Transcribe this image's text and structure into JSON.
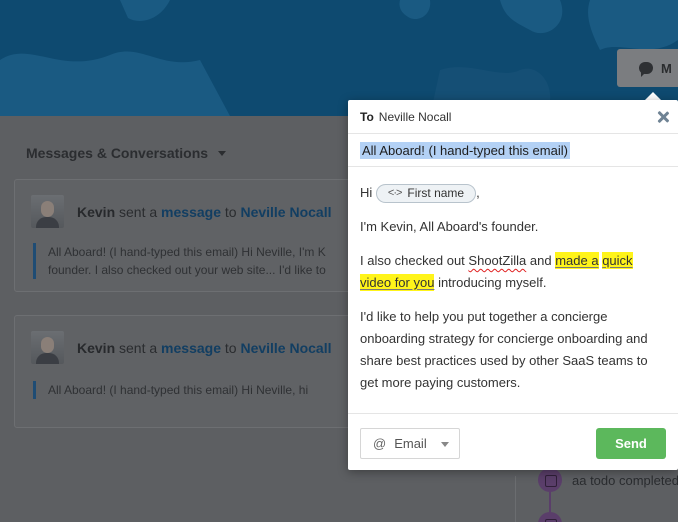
{
  "hero": {
    "button_label": "M"
  },
  "messages": {
    "section_title": "Messages & Conversations",
    "cards": [
      {
        "sender": "Kevin",
        "verb": "sent a",
        "object": "message",
        "to_word": "to",
        "recipient": "Neville Nocall",
        "preview_line1": "All Aboard! (I hand-typed this email) Hi Neville, I'm K",
        "preview_line2": "founder. I also checked out your web site... I'd like to"
      },
      {
        "sender": "Kevin",
        "verb": "sent a",
        "object": "message",
        "to_word": "to",
        "recipient": "Neville Nocall",
        "preview_line1": "All Aboard! (I hand-typed this email) Hi Neville, hi"
      }
    ]
  },
  "timeline": {
    "item_text": "aa todo completed"
  },
  "compose": {
    "to_label": "To",
    "to_name": "Neville Nocall",
    "subject": "All Aboard! (I hand-typed this email)",
    "greeting": "Hi",
    "token_label": "First name",
    "greeting_end": ",",
    "p1": "I'm Kevin, All Aboard's founder.",
    "p2_a": "I also checked out",
    "p2_brand": "ShootZilla",
    "p2_and": "and",
    "p2_hl1": "made a",
    "p2_hl2": "quick video for you",
    "p2_end": "introducing myself.",
    "p3": "I'd like to help you put together a concierge onboarding strategy for concierge onboarding and share best practices used by other SaaS teams to get more paying customers.",
    "channel_label": "Email",
    "send_label": "Send"
  },
  "colors": {
    "send_green": "#5cb85c",
    "highlight_yellow": "#fff41a",
    "selection_blue": "#b3d1f5",
    "link_blue": "#123e62"
  }
}
